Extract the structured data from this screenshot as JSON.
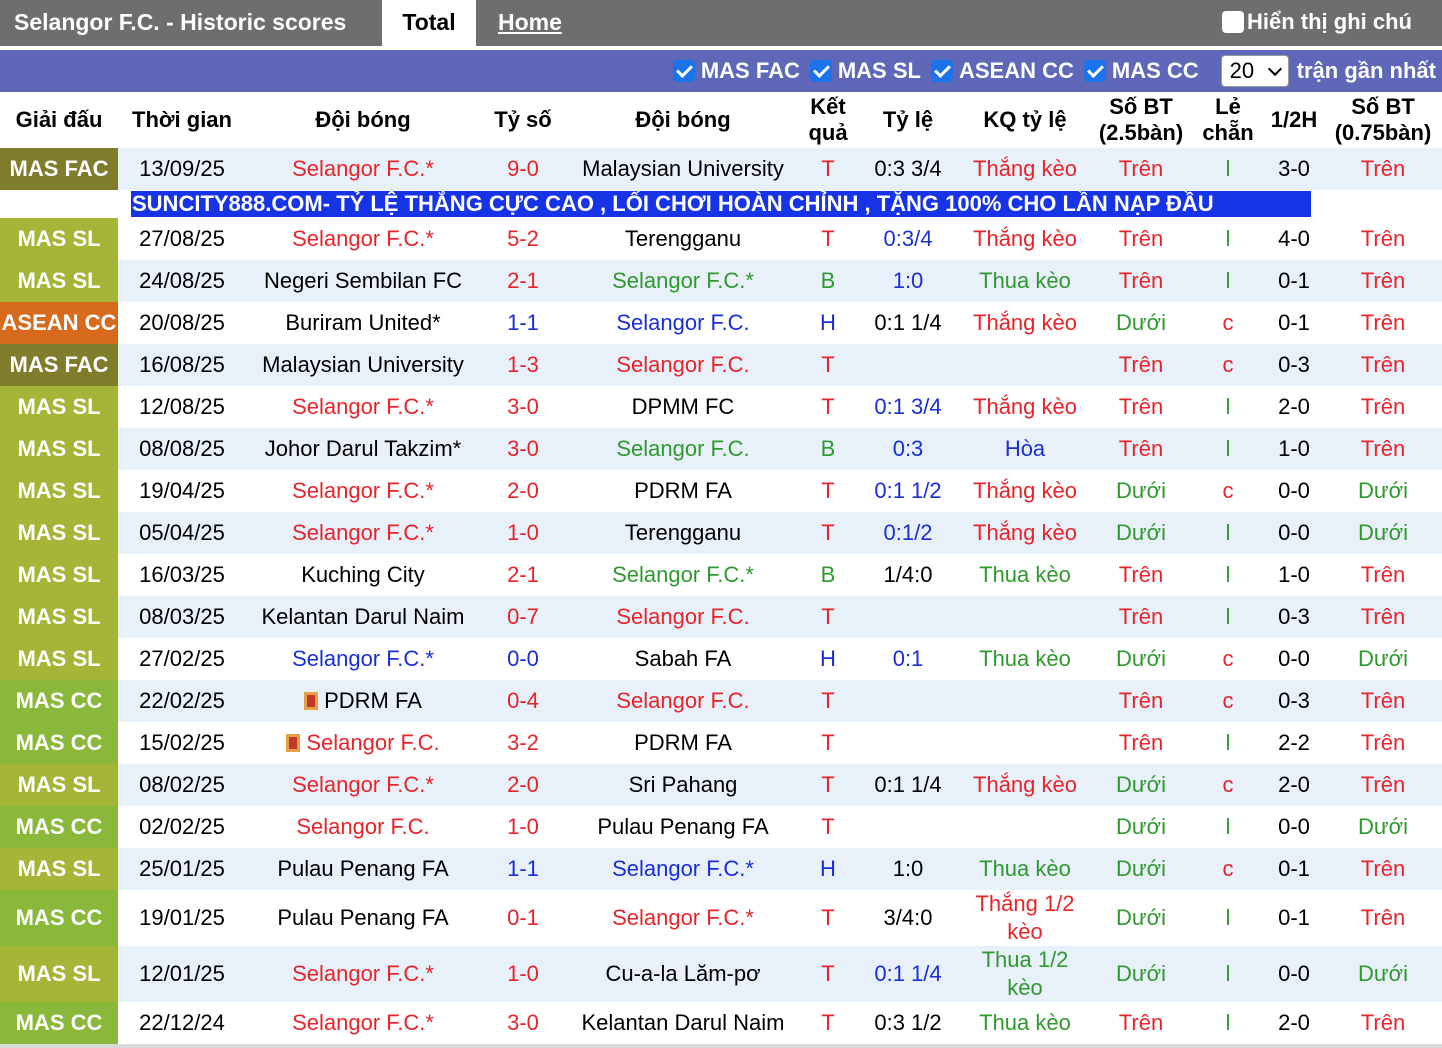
{
  "header": {
    "site_title": "Selangor F.C. - Historic scores",
    "tab_total": "Total",
    "tab_home": "Home",
    "show_notes": "Hiển thị ghi chú"
  },
  "filters": {
    "items": [
      "MAS FAC",
      "MAS SL",
      "ASEAN CC",
      "MAS CC"
    ],
    "count_value": "20",
    "count_suffix": "trận gần nhất"
  },
  "columns": [
    "Giải đấu",
    "Thời gian",
    "Đội bóng",
    "Tỷ số",
    "Đội bóng",
    "Kết quả",
    "Tỷ lệ",
    "KQ tỷ lệ",
    "Số BT (2.5bàn)",
    "Lẻ chẵn",
    "1/2H",
    "Số BT (0.75bàn)"
  ],
  "ad_text": "SUNCITY888.COM- TỶ LỆ THẮNG CỰC CAO , LỐI CHƠI HOÀN CHỈNH , TẶNG 100% CHO LẦN NẠP ĐẦU",
  "colors": {
    "mas_fac": "#7f7c2c",
    "mas_sl": "#a5b537",
    "asean_cc": "#d86a1e",
    "mas_cc": "#8ab83a",
    "red": "#e8242a",
    "green": "#2e9a2e",
    "blue": "#1a2ed8",
    "black": "#000000"
  },
  "matches": [
    {
      "league": "MAS FAC",
      "league_color": "#7f7c2c",
      "date": "13/09/25",
      "home": "Selangor F.C.*",
      "home_color": "#e8242a",
      "home_flag": false,
      "score": "9-0",
      "score_color": "#e8242a",
      "away": "Malaysian University",
      "away_color": "#000000",
      "result": "T",
      "result_color": "#e8242a",
      "odds": "0:3 3/4",
      "odds_color": "#000000",
      "odds_result": "Thắng kèo",
      "odds_result_color": "#e8242a",
      "ou": "Trên",
      "ou_color": "#e8242a",
      "oe": "l",
      "oe_color": "#2e9a2e",
      "half": "3-0",
      "ou2": "Trên",
      "ou2_color": "#e8242a"
    },
    {
      "league": "MAS SL",
      "league_color": "#a5b537",
      "date": "27/08/25",
      "home": "Selangor F.C.*",
      "home_color": "#e8242a",
      "home_flag": false,
      "score": "5-2",
      "score_color": "#e8242a",
      "away": "Terengganu",
      "away_color": "#000000",
      "result": "T",
      "result_color": "#e8242a",
      "odds": "0:3/4",
      "odds_color": "#1a2ed8",
      "odds_result": "Thắng kèo",
      "odds_result_color": "#e8242a",
      "ou": "Trên",
      "ou_color": "#e8242a",
      "oe": "l",
      "oe_color": "#2e9a2e",
      "half": "4-0",
      "ou2": "Trên",
      "ou2_color": "#e8242a"
    },
    {
      "league": "MAS SL",
      "league_color": "#a5b537",
      "date": "24/08/25",
      "home": "Negeri Sembilan FC",
      "home_color": "#000000",
      "home_flag": false,
      "score": "2-1",
      "score_color": "#e8242a",
      "away": "Selangor F.C.*",
      "away_color": "#2e9a2e",
      "result": "B",
      "result_color": "#2e9a2e",
      "odds": "1:0",
      "odds_color": "#1a2ed8",
      "odds_result": "Thua kèo",
      "odds_result_color": "#2e9a2e",
      "ou": "Trên",
      "ou_color": "#e8242a",
      "oe": "l",
      "oe_color": "#2e9a2e",
      "half": "0-1",
      "ou2": "Trên",
      "ou2_color": "#e8242a"
    },
    {
      "league": "ASEAN CC",
      "league_color": "#d86a1e",
      "date": "20/08/25",
      "home": "Buriram United*",
      "home_color": "#000000",
      "home_flag": false,
      "score": "1-1",
      "score_color": "#1a2ed8",
      "away": "Selangor F.C.",
      "away_color": "#1a2ed8",
      "result": "H",
      "result_color": "#1a2ed8",
      "odds": "0:1 1/4",
      "odds_color": "#000000",
      "odds_result": "Thắng kèo",
      "odds_result_color": "#e8242a",
      "ou": "Dưới",
      "ou_color": "#2e9a2e",
      "oe": "c",
      "oe_color": "#e8242a",
      "half": "0-1",
      "ou2": "Trên",
      "ou2_color": "#e8242a"
    },
    {
      "league": "MAS FAC",
      "league_color": "#7f7c2c",
      "date": "16/08/25",
      "home": "Malaysian University",
      "home_color": "#000000",
      "home_flag": false,
      "score": "1-3",
      "score_color": "#e8242a",
      "away": "Selangor F.C.",
      "away_color": "#e8242a",
      "result": "T",
      "result_color": "#e8242a",
      "odds": "",
      "odds_color": "#000000",
      "odds_result": "",
      "odds_result_color": "#000000",
      "ou": "Trên",
      "ou_color": "#e8242a",
      "oe": "c",
      "oe_color": "#e8242a",
      "half": "0-3",
      "ou2": "Trên",
      "ou2_color": "#e8242a"
    },
    {
      "league": "MAS SL",
      "league_color": "#a5b537",
      "date": "12/08/25",
      "home": "Selangor F.C.*",
      "home_color": "#e8242a",
      "home_flag": false,
      "score": "3-0",
      "score_color": "#e8242a",
      "away": "DPMM FC",
      "away_color": "#000000",
      "result": "T",
      "result_color": "#e8242a",
      "odds": "0:1 3/4",
      "odds_color": "#1a2ed8",
      "odds_result": "Thắng kèo",
      "odds_result_color": "#e8242a",
      "ou": "Trên",
      "ou_color": "#e8242a",
      "oe": "l",
      "oe_color": "#2e9a2e",
      "half": "2-0",
      "ou2": "Trên",
      "ou2_color": "#e8242a"
    },
    {
      "league": "MAS SL",
      "league_color": "#a5b537",
      "date": "08/08/25",
      "home": "Johor Darul Takzim*",
      "home_color": "#000000",
      "home_flag": false,
      "score": "3-0",
      "score_color": "#e8242a",
      "away": "Selangor F.C.",
      "away_color": "#2e9a2e",
      "result": "B",
      "result_color": "#2e9a2e",
      "odds": "0:3",
      "odds_color": "#1a2ed8",
      "odds_result": "Hòa",
      "odds_result_color": "#1a2ed8",
      "ou": "Trên",
      "ou_color": "#e8242a",
      "oe": "l",
      "oe_color": "#2e9a2e",
      "half": "1-0",
      "ou2": "Trên",
      "ou2_color": "#e8242a"
    },
    {
      "league": "MAS SL",
      "league_color": "#a5b537",
      "date": "19/04/25",
      "home": "Selangor F.C.*",
      "home_color": "#e8242a",
      "home_flag": false,
      "score": "2-0",
      "score_color": "#e8242a",
      "away": "PDRM FA",
      "away_color": "#000000",
      "result": "T",
      "result_color": "#e8242a",
      "odds": "0:1 1/2",
      "odds_color": "#1a2ed8",
      "odds_result": "Thắng kèo",
      "odds_result_color": "#e8242a",
      "ou": "Dưới",
      "ou_color": "#2e9a2e",
      "oe": "c",
      "oe_color": "#e8242a",
      "half": "0-0",
      "ou2": "Dưới",
      "ou2_color": "#2e9a2e"
    },
    {
      "league": "MAS SL",
      "league_color": "#a5b537",
      "date": "05/04/25",
      "home": "Selangor F.C.*",
      "home_color": "#e8242a",
      "home_flag": false,
      "score": "1-0",
      "score_color": "#e8242a",
      "away": "Terengganu",
      "away_color": "#000000",
      "result": "T",
      "result_color": "#e8242a",
      "odds": "0:1/2",
      "odds_color": "#1a2ed8",
      "odds_result": "Thắng kèo",
      "odds_result_color": "#e8242a",
      "ou": "Dưới",
      "ou_color": "#2e9a2e",
      "oe": "l",
      "oe_color": "#2e9a2e",
      "half": "0-0",
      "ou2": "Dưới",
      "ou2_color": "#2e9a2e"
    },
    {
      "league": "MAS SL",
      "league_color": "#a5b537",
      "date": "16/03/25",
      "home": "Kuching City",
      "home_color": "#000000",
      "home_flag": false,
      "score": "2-1",
      "score_color": "#e8242a",
      "away": "Selangor F.C.*",
      "away_color": "#2e9a2e",
      "result": "B",
      "result_color": "#2e9a2e",
      "odds": "1/4:0",
      "odds_color": "#000000",
      "odds_result": "Thua kèo",
      "odds_result_color": "#2e9a2e",
      "ou": "Trên",
      "ou_color": "#e8242a",
      "oe": "l",
      "oe_color": "#2e9a2e",
      "half": "1-0",
      "ou2": "Trên",
      "ou2_color": "#e8242a"
    },
    {
      "league": "MAS SL",
      "league_color": "#a5b537",
      "date": "08/03/25",
      "home": "Kelantan Darul Naim",
      "home_color": "#000000",
      "home_flag": false,
      "score": "0-7",
      "score_color": "#e8242a",
      "away": "Selangor F.C.",
      "away_color": "#e8242a",
      "result": "T",
      "result_color": "#e8242a",
      "odds": "",
      "odds_color": "#000000",
      "odds_result": "",
      "odds_result_color": "#000000",
      "ou": "Trên",
      "ou_color": "#e8242a",
      "oe": "l",
      "oe_color": "#2e9a2e",
      "half": "0-3",
      "ou2": "Trên",
      "ou2_color": "#e8242a"
    },
    {
      "league": "MAS SL",
      "league_color": "#a5b537",
      "date": "27/02/25",
      "home": "Selangor F.C.*",
      "home_color": "#1a2ed8",
      "home_flag": false,
      "score": "0-0",
      "score_color": "#1a2ed8",
      "away": "Sabah FA",
      "away_color": "#000000",
      "result": "H",
      "result_color": "#1a2ed8",
      "odds": "0:1",
      "odds_color": "#1a2ed8",
      "odds_result": "Thua kèo",
      "odds_result_color": "#2e9a2e",
      "ou": "Dưới",
      "ou_color": "#2e9a2e",
      "oe": "c",
      "oe_color": "#e8242a",
      "half": "0-0",
      "ou2": "Dưới",
      "ou2_color": "#2e9a2e"
    },
    {
      "league": "MAS CC",
      "league_color": "#8ab83a",
      "date": "22/02/25",
      "home": "PDRM FA",
      "home_color": "#000000",
      "home_flag": true,
      "score": "0-4",
      "score_color": "#e8242a",
      "away": "Selangor F.C.",
      "away_color": "#e8242a",
      "result": "T",
      "result_color": "#e8242a",
      "odds": "",
      "odds_color": "#000000",
      "odds_result": "",
      "odds_result_color": "#000000",
      "ou": "Trên",
      "ou_color": "#e8242a",
      "oe": "c",
      "oe_color": "#e8242a",
      "half": "0-3",
      "ou2": "Trên",
      "ou2_color": "#e8242a"
    },
    {
      "league": "MAS CC",
      "league_color": "#8ab83a",
      "date": "15/02/25",
      "home": "Selangor F.C.",
      "home_color": "#e8242a",
      "home_flag": true,
      "score": "3-2",
      "score_color": "#e8242a",
      "away": "PDRM FA",
      "away_color": "#000000",
      "result": "T",
      "result_color": "#e8242a",
      "odds": "",
      "odds_color": "#000000",
      "odds_result": "",
      "odds_result_color": "#000000",
      "ou": "Trên",
      "ou_color": "#e8242a",
      "oe": "l",
      "oe_color": "#2e9a2e",
      "half": "2-2",
      "ou2": "Trên",
      "ou2_color": "#e8242a"
    },
    {
      "league": "MAS SL",
      "league_color": "#a5b537",
      "date": "08/02/25",
      "home": "Selangor F.C.*",
      "home_color": "#e8242a",
      "home_flag": false,
      "score": "2-0",
      "score_color": "#e8242a",
      "away": "Sri Pahang",
      "away_color": "#000000",
      "result": "T",
      "result_color": "#e8242a",
      "odds": "0:1 1/4",
      "odds_color": "#000000",
      "odds_result": "Thắng kèo",
      "odds_result_color": "#e8242a",
      "ou": "Dưới",
      "ou_color": "#2e9a2e",
      "oe": "c",
      "oe_color": "#e8242a",
      "half": "2-0",
      "ou2": "Trên",
      "ou2_color": "#e8242a"
    },
    {
      "league": "MAS CC",
      "league_color": "#8ab83a",
      "date": "02/02/25",
      "home": "Selangor F.C.",
      "home_color": "#e8242a",
      "home_flag": false,
      "score": "1-0",
      "score_color": "#e8242a",
      "away": "Pulau Penang FA",
      "away_color": "#000000",
      "result": "T",
      "result_color": "#e8242a",
      "odds": "",
      "odds_color": "#000000",
      "odds_result": "",
      "odds_result_color": "#000000",
      "ou": "Dưới",
      "ou_color": "#2e9a2e",
      "oe": "l",
      "oe_color": "#2e9a2e",
      "half": "0-0",
      "ou2": "Dưới",
      "ou2_color": "#2e9a2e"
    },
    {
      "league": "MAS SL",
      "league_color": "#a5b537",
      "date": "25/01/25",
      "home": "Pulau Penang FA",
      "home_color": "#000000",
      "home_flag": false,
      "score": "1-1",
      "score_color": "#1a2ed8",
      "away": "Selangor F.C.*",
      "away_color": "#1a2ed8",
      "result": "H",
      "result_color": "#1a2ed8",
      "odds": "1:0",
      "odds_color": "#000000",
      "odds_result": "Thua kèo",
      "odds_result_color": "#2e9a2e",
      "ou": "Dưới",
      "ou_color": "#2e9a2e",
      "oe": "c",
      "oe_color": "#e8242a",
      "half": "0-1",
      "ou2": "Trên",
      "ou2_color": "#e8242a"
    },
    {
      "league": "MAS CC",
      "league_color": "#8ab83a",
      "date": "19/01/25",
      "home": "Pulau Penang FA",
      "home_color": "#000000",
      "home_flag": false,
      "score": "0-1",
      "score_color": "#e8242a",
      "away": "Selangor F.C.*",
      "away_color": "#e8242a",
      "result": "T",
      "result_color": "#e8242a",
      "odds": "3/4:0",
      "odds_color": "#000000",
      "odds_result": "Thắng 1/2 kèo",
      "odds_result_color": "#e8242a",
      "ou": "Dưới",
      "ou_color": "#2e9a2e",
      "oe": "l",
      "oe_color": "#2e9a2e",
      "half": "0-1",
      "ou2": "Trên",
      "ou2_color": "#e8242a",
      "tall": true
    },
    {
      "league": "MAS SL",
      "league_color": "#a5b537",
      "date": "12/01/25",
      "home": "Selangor F.C.*",
      "home_color": "#e8242a",
      "home_flag": false,
      "score": "1-0",
      "score_color": "#e8242a",
      "away": "Cu-a-la Lăm-pơ",
      "away_color": "#000000",
      "result": "T",
      "result_color": "#e8242a",
      "odds": "0:1 1/4",
      "odds_color": "#1a2ed8",
      "odds_result": "Thua 1/2 kèo",
      "odds_result_color": "#2e9a2e",
      "ou": "Dưới",
      "ou_color": "#2e9a2e",
      "oe": "l",
      "oe_color": "#2e9a2e",
      "half": "0-0",
      "ou2": "Dưới",
      "ou2_color": "#2e9a2e",
      "tall": true
    },
    {
      "league": "MAS CC",
      "league_color": "#8ab83a",
      "date": "22/12/24",
      "home": "Selangor F.C.*",
      "home_color": "#e8242a",
      "home_flag": false,
      "score": "3-0",
      "score_color": "#e8242a",
      "away": "Kelantan Darul Naim",
      "away_color": "#000000",
      "result": "T",
      "result_color": "#e8242a",
      "odds": "0:3 1/2",
      "odds_color": "#000000",
      "odds_result": "Thua kèo",
      "odds_result_color": "#2e9a2e",
      "ou": "Trên",
      "ou_color": "#e8242a",
      "oe": "l",
      "oe_color": "#2e9a2e",
      "half": "2-0",
      "ou2": "Trên",
      "ou2_color": "#e8242a"
    }
  ]
}
